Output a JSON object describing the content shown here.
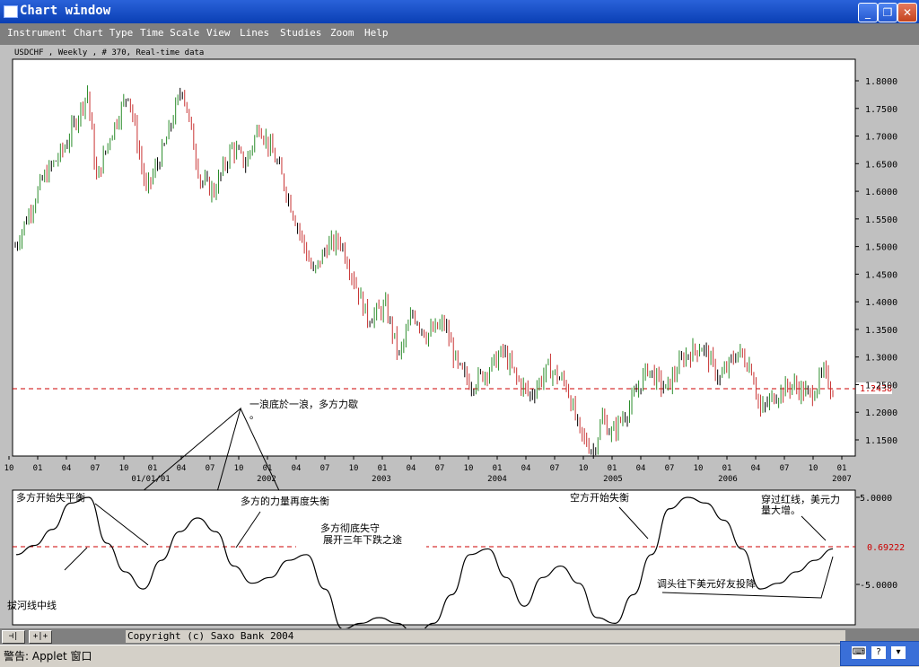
{
  "window": {
    "title": "Chart window",
    "buttons": {
      "minimize": "_",
      "restore": "❐",
      "close": "✕"
    }
  },
  "menu": [
    "Instrument",
    "Chart Type",
    "Time Scale",
    "View",
    "Lines",
    "Studies",
    "Zoom",
    "Help"
  ],
  "chart_data": [
    {
      "type": "bar",
      "subtype": "ohlc",
      "title": "USDCHF , Weekly , # 370, Real-time data",
      "ylim": [
        1.12,
        1.85
      ],
      "y_ticks": [
        "1.8000",
        "1.7500",
        "1.7000",
        "1.6500",
        "1.6000",
        "1.5500",
        "1.5000",
        "1.4500",
        "1.4000",
        "1.3500",
        "1.3000",
        "1.2500",
        "1.2000",
        "1.1500"
      ],
      "last_price": "1.2438",
      "x_month_ticks": [
        "10",
        "01",
        "04",
        "07",
        "10",
        "01",
        "04",
        "07",
        "10",
        "01",
        "04",
        "07",
        "10",
        "01",
        "04",
        "07",
        "10",
        "01",
        "04",
        "07",
        "10",
        "01",
        "04",
        "07",
        "10",
        "01",
        "04",
        "07",
        "10",
        "01"
      ],
      "x_year_labels": [
        "01/01/01",
        "2002",
        "2003",
        "2004",
        "2005",
        "2006",
        "2007"
      ],
      "price_path": [
        [
          0,
          1.5
        ],
        [
          12,
          1.62
        ],
        [
          22,
          1.68
        ],
        [
          32,
          1.78
        ],
        [
          36,
          1.62
        ],
        [
          42,
          1.7
        ],
        [
          50,
          1.78
        ],
        [
          58,
          1.6
        ],
        [
          66,
          1.68
        ],
        [
          74,
          1.79
        ],
        [
          82,
          1.62
        ],
        [
          88,
          1.6
        ],
        [
          96,
          1.68
        ],
        [
          102,
          1.65
        ],
        [
          108,
          1.72
        ],
        [
          116,
          1.65
        ],
        [
          124,
          1.55
        ],
        [
          132,
          1.45
        ],
        [
          138,
          1.5
        ],
        [
          144,
          1.51
        ],
        [
          150,
          1.44
        ],
        [
          156,
          1.37
        ],
        [
          164,
          1.39
        ],
        [
          170,
          1.3
        ],
        [
          176,
          1.38
        ],
        [
          182,
          1.34
        ],
        [
          190,
          1.36
        ],
        [
          196,
          1.28
        ],
        [
          202,
          1.25
        ],
        [
          210,
          1.28
        ],
        [
          216,
          1.31
        ],
        [
          222,
          1.26
        ],
        [
          228,
          1.23
        ],
        [
          236,
          1.28
        ],
        [
          244,
          1.25
        ],
        [
          250,
          1.16
        ],
        [
          256,
          1.13
        ],
        [
          260,
          1.19
        ],
        [
          264,
          1.16
        ],
        [
          272,
          1.21
        ],
        [
          280,
          1.28
        ],
        [
          288,
          1.24
        ],
        [
          296,
          1.3
        ],
        [
          304,
          1.32
        ],
        [
          312,
          1.26
        ],
        [
          320,
          1.31
        ],
        [
          326,
          1.28
        ],
        [
          330,
          1.2
        ],
        [
          336,
          1.23
        ],
        [
          344,
          1.25
        ],
        [
          352,
          1.23
        ],
        [
          358,
          1.27
        ],
        [
          362,
          1.24
        ]
      ],
      "reference_line": 1.2438
    },
    {
      "type": "line",
      "y_ticks": [
        "5.0000",
        "-5.0000"
      ],
      "reference_value": "0.69222",
      "values": [
        0.0,
        0.8,
        2.2,
        4.5,
        5.0,
        1.0,
        -1.5,
        -3.0,
        -0.5,
        2.0,
        3.2,
        2.0,
        -1.0,
        -2.5,
        -2.0,
        -0.5,
        0.0,
        -3.0,
        -6.5,
        -6.0,
        -5.5,
        -6.0,
        -7.0,
        -6.0,
        -3.5,
        0.0,
        0.5,
        -2.0,
        -4.5,
        -2.0,
        -1.0,
        -2.5,
        -5.5,
        -6.0,
        -3.5,
        0.0,
        4.0,
        5.0,
        4.5,
        3.0,
        0.5,
        -3.0,
        -2.5,
        -1.5,
        -0.5,
        0.5
      ]
    }
  ],
  "annotations": {
    "a1": "一浪底於一浪，多方力歇",
    "a1b": "。",
    "a2": "多方开始失平衡",
    "a3": "多方的力量再度失衡",
    "a4": "多方彻底失守",
    "a5": "展开三年下跌之途",
    "a6": "空方开始失衡",
    "a7": "穿过红线，美元力",
    "a8": "量大增。",
    "a9": "拔河线中线",
    "a10": "调头往下美元好友投降"
  },
  "toolbar": {
    "btn1": "⊣|",
    "btn2": "+|+"
  },
  "copyright": "Copyright (c) Saxo Bank 2004",
  "status": "警告: Applet 窗口",
  "tray": {
    "keyboard": "⌨",
    "help": "?",
    "arrow": "▾"
  },
  "colors": {
    "up": "#2a8c2a",
    "down": "#c83232",
    "neutral": "#000000",
    "ref": "#cc0000"
  }
}
